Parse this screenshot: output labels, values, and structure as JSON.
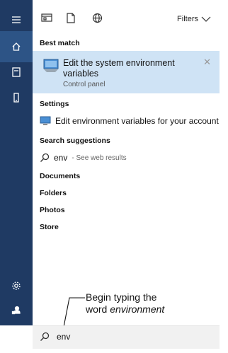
{
  "toolbar": {
    "filters_label": "Filters"
  },
  "sections": {
    "best_match": "Best match",
    "settings": "Settings",
    "search_suggestions": "Search suggestions",
    "documents": "Documents",
    "folders": "Folders",
    "photos": "Photos",
    "store": "Store"
  },
  "best_match": {
    "title": "Edit the system environment variables",
    "subtitle": "Control panel"
  },
  "settings_item": {
    "label": "Edit environment variables for your account"
  },
  "suggestion": {
    "query": "env",
    "hint": "- See web results"
  },
  "callout": {
    "line1": "Begin typing the",
    "line2_prefix": "word ",
    "line2_em": "environment"
  },
  "search_box": {
    "value": "env"
  },
  "colors": {
    "rail": "#1f3a63",
    "rail_active": "#2d5486",
    "highlight": "#cfe3f5"
  }
}
